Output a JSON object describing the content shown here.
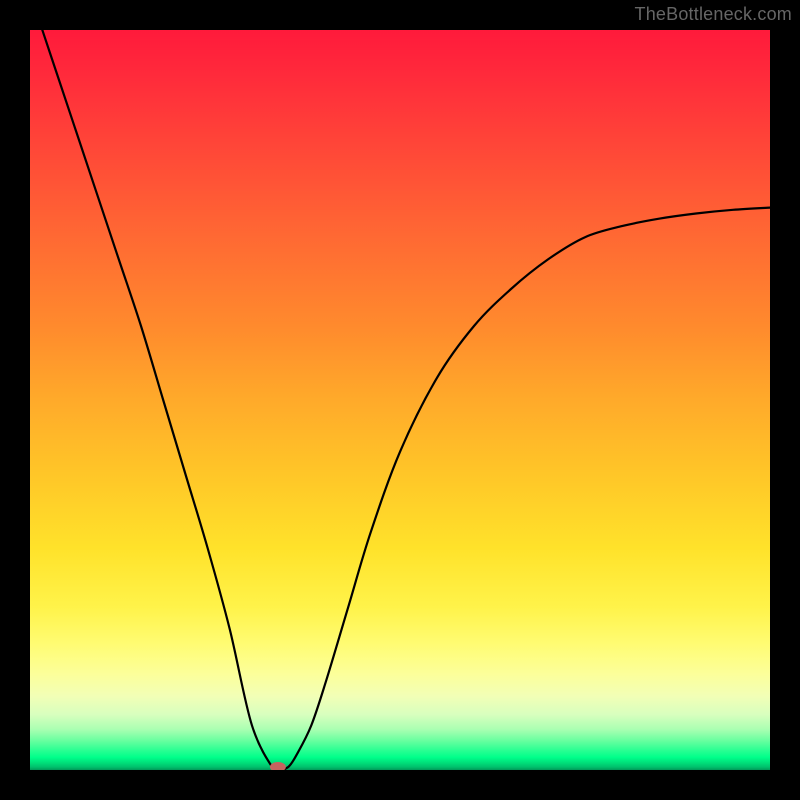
{
  "watermark": "TheBottleneck.com",
  "chart_data": {
    "type": "line",
    "title": "",
    "xlabel": "",
    "ylabel": "",
    "curve": {
      "x": [
        0.0,
        0.03,
        0.06,
        0.09,
        0.12,
        0.15,
        0.18,
        0.21,
        0.24,
        0.27,
        0.3,
        0.33,
        0.34,
        0.35,
        0.36,
        0.38,
        0.4,
        0.43,
        0.46,
        0.5,
        0.55,
        0.6,
        0.65,
        0.7,
        0.75,
        0.8,
        0.85,
        0.9,
        0.95,
        1.0
      ],
      "y": [
        1.05,
        0.96,
        0.87,
        0.78,
        0.69,
        0.6,
        0.5,
        0.4,
        0.3,
        0.19,
        0.06,
        0.0,
        0.0,
        0.005,
        0.02,
        0.06,
        0.12,
        0.22,
        0.32,
        0.43,
        0.53,
        0.6,
        0.65,
        0.69,
        0.72,
        0.735,
        0.745,
        0.752,
        0.757,
        0.76
      ]
    },
    "min_marker": {
      "x": 0.335,
      "y": 0.0
    },
    "xlim": [
      0,
      1
    ],
    "ylim": [
      0,
      1
    ],
    "background_gradient": {
      "top": "#ff1a3b",
      "bottom": "#009a58"
    }
  }
}
